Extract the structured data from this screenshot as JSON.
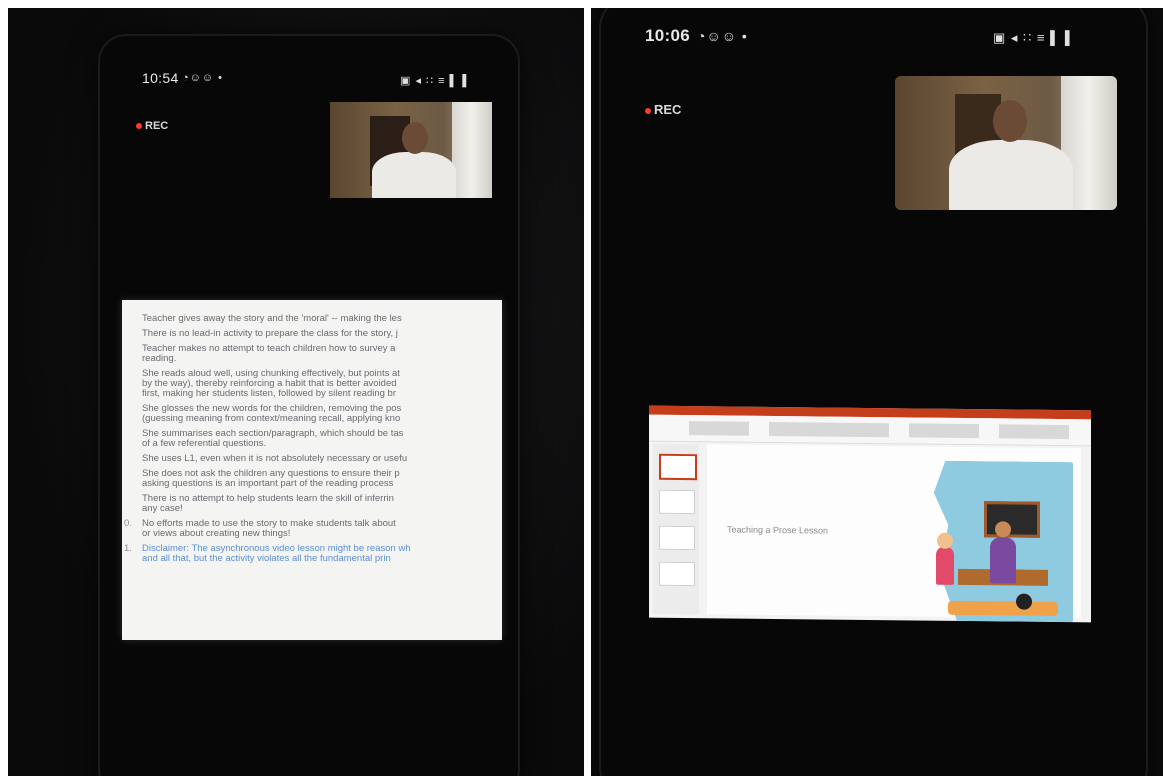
{
  "left_photo": {
    "status_time": "10:54",
    "status_icons": "◔☺☺ •",
    "status_right": "▣ ◂ ∷ ≡ ▌▐",
    "rec_label": "REC",
    "slide_bullets": [
      {
        "num": "",
        "text": "Teacher gives away the story and the 'moral' -- making the les"
      },
      {
        "num": "",
        "text": "There is no lead-in activity to prepare the class for the story, j"
      },
      {
        "num": "",
        "text": "Teacher makes no attempt to teach children how to survey a"
      },
      {
        "num": "",
        "text": "reading."
      },
      {
        "num": "",
        "text": "She reads aloud well, using chunking effectively, but points at"
      },
      {
        "num": "",
        "text": "by the way), thereby reinforcing a habit that is better avoided"
      },
      {
        "num": "",
        "text": "first, making her students listen, followed by silent reading br"
      },
      {
        "num": "",
        "text": "She glosses the new words for the children, removing the pos"
      },
      {
        "num": "",
        "text": "(guessing meaning from context/meaning recall, applying kno"
      },
      {
        "num": "",
        "text": "She summarises each section/paragraph, which should be tas"
      },
      {
        "num": "",
        "text": "of a few referential questions."
      },
      {
        "num": "",
        "text": "She uses L1, even when it is not absolutely necessary or usefu"
      },
      {
        "num": "",
        "text": "She does not ask the children any questions to ensure their p"
      },
      {
        "num": "",
        "text": "asking questions is an important part of the reading process"
      },
      {
        "num": "",
        "text": "There is no attempt to help students learn the skill of inferrin"
      },
      {
        "num": "",
        "text": "any case!"
      },
      {
        "num": "0.",
        "text": "No efforts made to use the story to make students talk about"
      },
      {
        "num": "",
        "text": "or views about creating new things!"
      },
      {
        "num": "1.",
        "text": "Disclaimer: The asynchronous video lesson might be reason wh",
        "blue": true
      },
      {
        "num": "",
        "text": "and all that, but the activity violates all the fundamental prin",
        "blue": true
      }
    ]
  },
  "right_photo": {
    "status_time": "10:06",
    "status_icons": "◔☺☺ •",
    "status_right": "▣ ◂ ∷ ≡ ▌▐",
    "rec_label": "REC",
    "slide_text": "Teaching a Prose Lesson"
  }
}
